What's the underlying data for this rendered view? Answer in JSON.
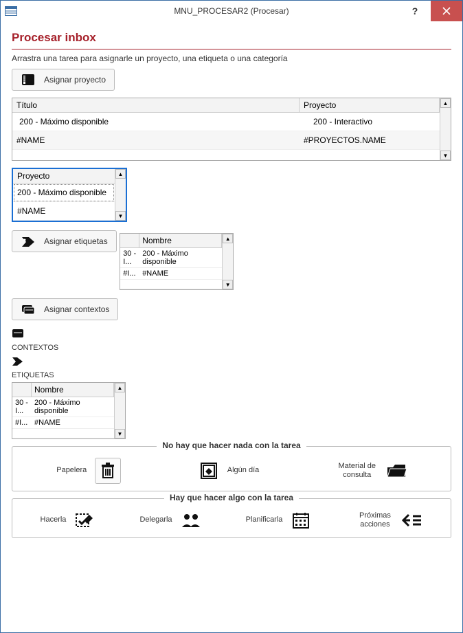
{
  "window": {
    "title": "MNU_PROCESAR2 (Procesar)"
  },
  "page": {
    "heading": "Procesar inbox",
    "instruction": "Arrastra una tarea para asignarle un proyecto, una etiqueta o una categoría"
  },
  "buttons": {
    "assign_project": "Asignar proyecto",
    "assign_labels": "Asignar etiquetas",
    "assign_contexts": "Asignar contextos"
  },
  "tasks_grid": {
    "col_title": "Título",
    "col_project": "Proyecto",
    "rows": [
      {
        "titulo": "200 - Máximo disponible",
        "proyecto": "200 - Interactivo"
      },
      {
        "titulo": "#NAME",
        "proyecto": "#PROYECTOS.NAME"
      }
    ]
  },
  "projects_list": {
    "header": "Proyecto",
    "rows": [
      "200 - Máximo disponible",
      "#NAME"
    ]
  },
  "labels_grid": {
    "col_blank": "",
    "col_name": "Nombre",
    "rows": [
      {
        "c1": "30 - I...",
        "c2": "200 - Máximo disponible"
      },
      {
        "c1": "#I...",
        "c2": "#NAME"
      }
    ]
  },
  "sections": {
    "contexts_label": "CONTEXTOS",
    "labels_label": "ETIQUETAS"
  },
  "nothing_group": {
    "legend": "No hay que hacer nada con la tarea",
    "trash": "Papelera",
    "someday": "Algún día",
    "reference": "Material de consulta"
  },
  "something_group": {
    "legend": "Hay que hacer algo con la tarea",
    "do_it": "Hacerla",
    "delegate": "Delegarla",
    "schedule": "Planificarla",
    "next": "Próximas acciones"
  }
}
